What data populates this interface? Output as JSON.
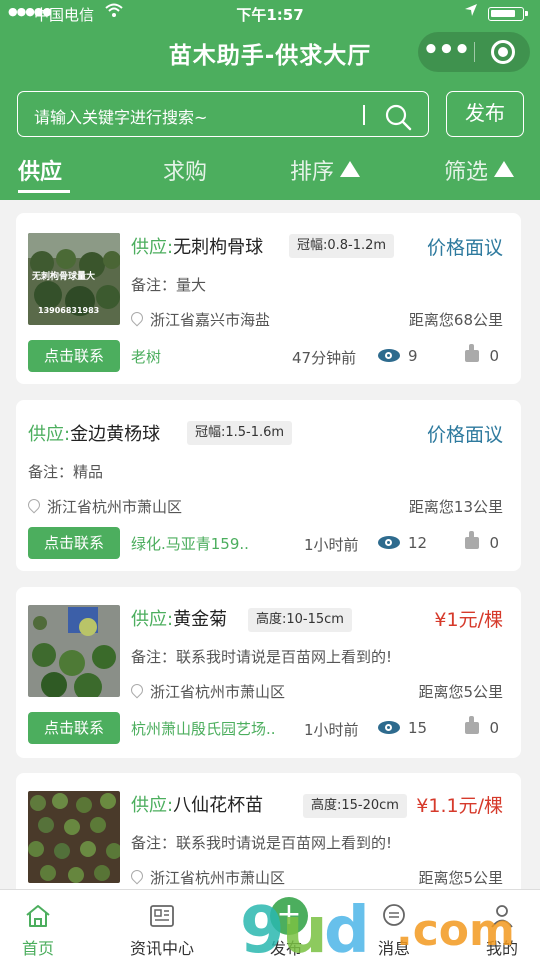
{
  "status_bar": {
    "carrier": "中国电信",
    "time": "下午1:57"
  },
  "header": {
    "title": "苗木助手-供求大厅",
    "more_icon": "•••",
    "publish_label": "发布"
  },
  "search": {
    "placeholder": "请输入关键字进行搜索~"
  },
  "tabs": [
    {
      "label": "供应",
      "active": true
    },
    {
      "label": "求购"
    },
    {
      "label": "排序"
    },
    {
      "label": "筛选"
    }
  ],
  "listings": [
    {
      "type": "供应:",
      "name": "无刺枸骨球",
      "tag": "冠幅:0.8-1.2m",
      "price": "价格面议",
      "remark": "备注：量大",
      "location": "浙江省嘉兴市海盐",
      "distance": "距离您68公里",
      "contact": "点击联系",
      "seller": "老树",
      "ago": "47分钟前",
      "views": "9",
      "likes": "0",
      "thumb_caption": "无刺枸骨球量大"
    },
    {
      "type": "供应:",
      "name": "金边黄杨球",
      "tag": "冠幅:1.5-1.6m",
      "price": "价格面议",
      "remark": "备注：精品",
      "location": "浙江省杭州市萧山区",
      "distance": "距离您13公里",
      "contact": "点击联系",
      "seller": "绿化.马亚青159..",
      "ago": "1小时前",
      "views": "12",
      "likes": "0"
    },
    {
      "type": "供应:",
      "name": "黄金菊",
      "tag": "高度:10-15cm",
      "price": "¥1元/棵",
      "remark": "备注：联系我时请说是百苗网上看到的!",
      "location": "浙江省杭州市萧山区",
      "distance": "距离您5公里",
      "contact": "点击联系",
      "seller": "杭州萧山殷氏园艺场..",
      "ago": "1小时前",
      "views": "15",
      "likes": "0"
    },
    {
      "type": "供应:",
      "name": "八仙花杯苗",
      "tag": "高度:15-20cm",
      "price": "¥1.1元/棵",
      "remark": "备注：联系我时请说是百苗网上看到的!",
      "location": "浙江省杭州市萧山区",
      "distance": "距离您5公里"
    }
  ],
  "tabbar": [
    {
      "label": "首页",
      "icon": "home-icon",
      "active": true
    },
    {
      "label": "资讯中心",
      "icon": "news-icon"
    },
    {
      "label": "发布",
      "icon": "plus-icon"
    },
    {
      "label": "消息",
      "icon": "message-icon"
    },
    {
      "label": "我的",
      "icon": "user-icon"
    }
  ],
  "colors": {
    "brand": "#4cae5e",
    "price": "#d63a2b",
    "negotiable": "#2e7a9e"
  }
}
